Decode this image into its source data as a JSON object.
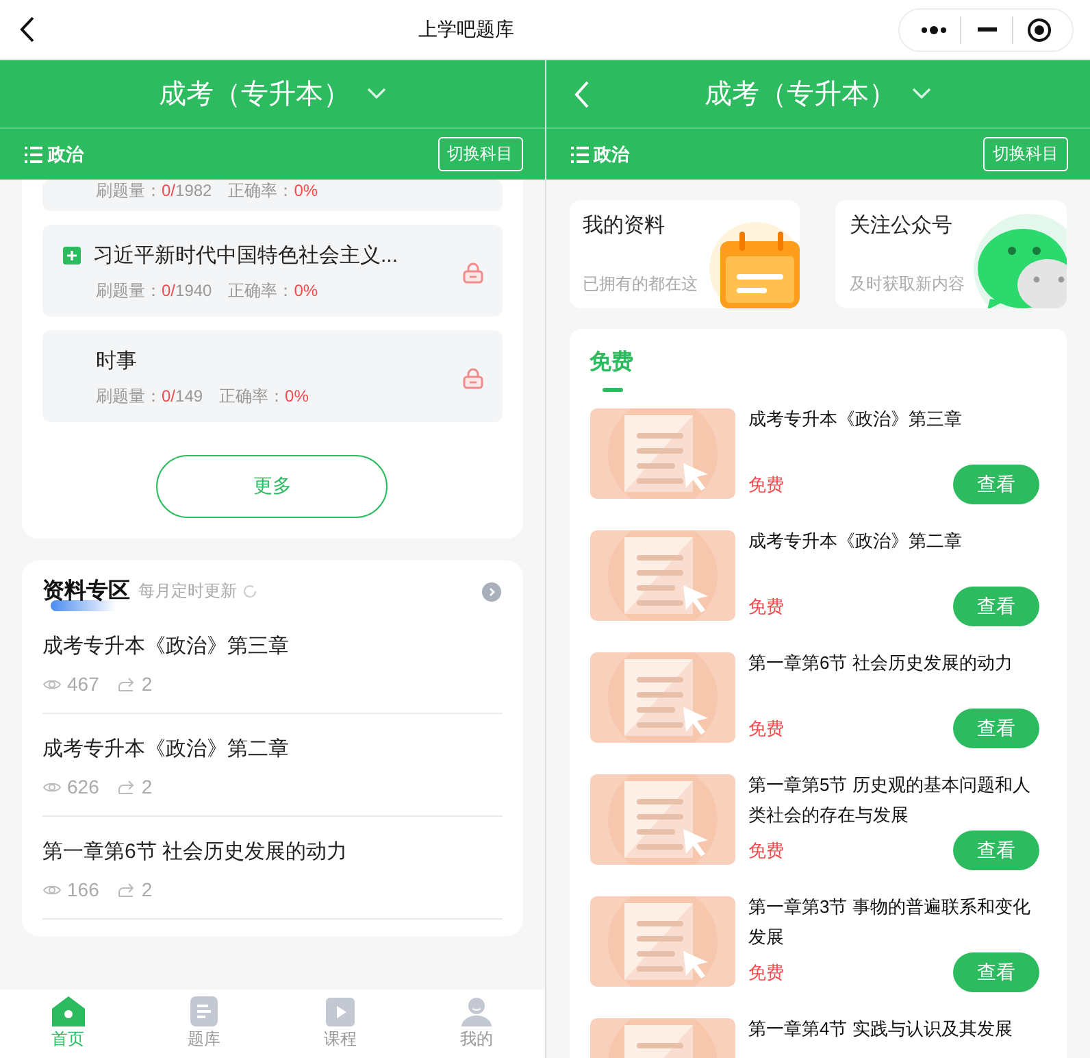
{
  "top_bar": {
    "title": "上学吧题库"
  },
  "left": {
    "header": {
      "title": "成考（专升本）"
    },
    "subject": {
      "name": "政治",
      "switch_label": "切换科目"
    },
    "question_sets": [
      {
        "count_label": "刷题量：",
        "done": "0/",
        "total": "1982",
        "accuracy_label": "正确率：",
        "accuracy": "0%"
      },
      {
        "title": "习近平新时代中国特色社会主义...",
        "expandable": true,
        "locked": true,
        "count_label": "刷题量：",
        "done": "0/",
        "total": "1940",
        "accuracy_label": "正确率：",
        "accuracy": "0%"
      },
      {
        "title": "时事",
        "expandable": false,
        "locked": true,
        "count_label": "刷题量：",
        "done": "0/",
        "total": "149",
        "accuracy_label": "正确率：",
        "accuracy": "0%"
      }
    ],
    "more_button": "更多",
    "materials": {
      "title": "资料专区",
      "subtitle": "每月定时更新",
      "items": [
        {
          "title": "成考专升本《政治》第三章",
          "views": "467",
          "shares": "2"
        },
        {
          "title": "成考专升本《政治》第二章",
          "views": "626",
          "shares": "2"
        },
        {
          "title": "第一章第6节 社会历史发展的动力",
          "views": "166",
          "shares": "2"
        }
      ]
    },
    "tab_bar": [
      {
        "label": "首页",
        "kind": "home",
        "selected": true
      },
      {
        "label": "题库",
        "kind": "bank",
        "selected": false
      },
      {
        "label": "课程",
        "kind": "course",
        "selected": false
      },
      {
        "label": "我的",
        "kind": "me",
        "selected": false
      }
    ]
  },
  "right": {
    "header": {
      "title": "成考（专升本）"
    },
    "subject": {
      "name": "政治",
      "switch_label": "切换科目"
    },
    "shortcuts": [
      {
        "title": "我的资料",
        "subtitle": "已拥有的都在这",
        "kind": "calendar"
      },
      {
        "title": "关注公众号",
        "subtitle": "及时获取新内容",
        "kind": "chat"
      }
    ],
    "free": {
      "tab_label": "免费",
      "items": [
        {
          "title": "成考专升本《政治》第三章",
          "price": "免费",
          "button": "查看"
        },
        {
          "title": "成考专升本《政治》第二章",
          "price": "免费",
          "button": "查看"
        },
        {
          "title": "第一章第6节 社会历史发展的动力",
          "price": "免费",
          "button": "查看"
        },
        {
          "title": "第一章第5节 历史观的基本问题和人类社会的存在与发展",
          "price": "免费",
          "button": "查看"
        },
        {
          "title": "第一章第3节 事物的普遍联系和变化发展",
          "price": "免费",
          "button": "查看"
        },
        {
          "title": "第一章第4节 实践与认识及其发展"
        }
      ]
    }
  }
}
